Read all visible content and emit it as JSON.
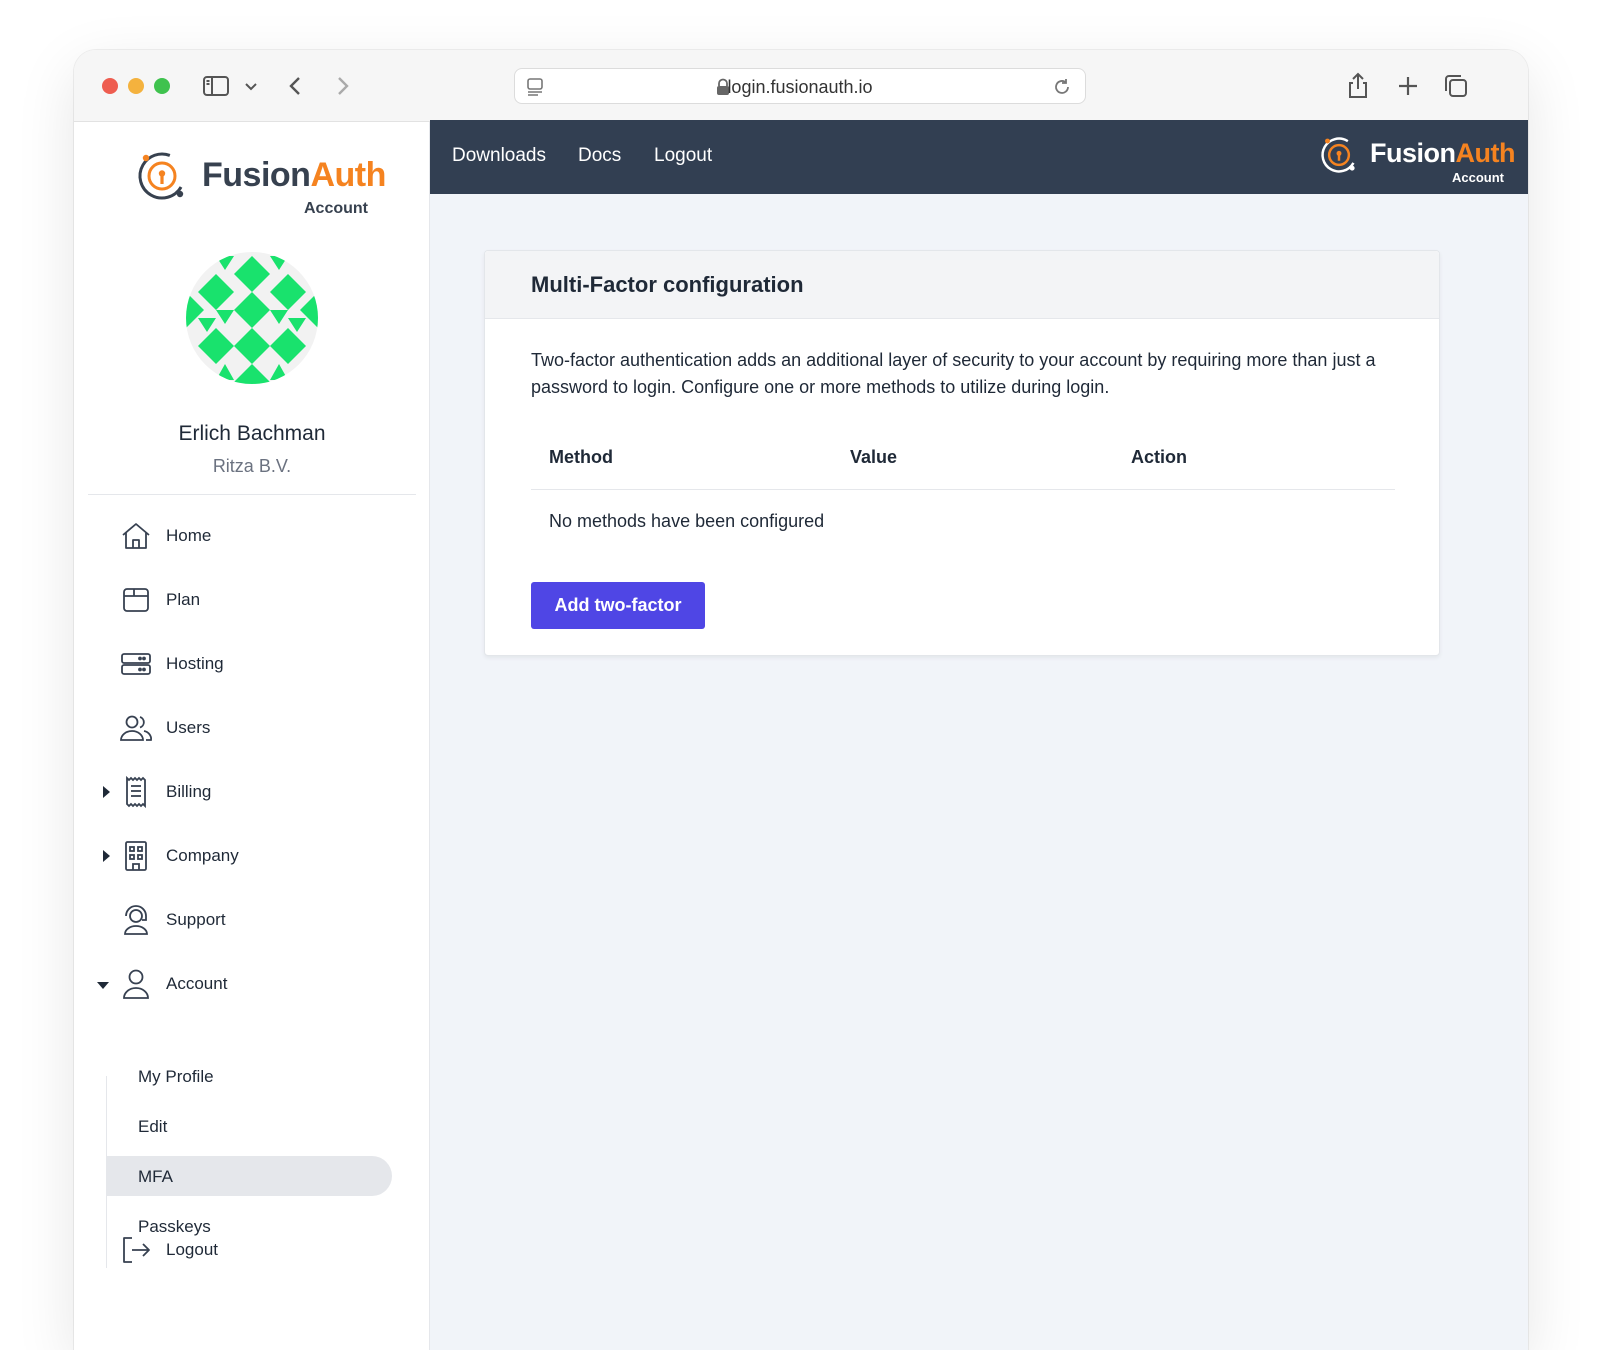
{
  "browser": {
    "url": "login.fusionauth.io"
  },
  "brand": {
    "name_first": "Fusion",
    "name_second": "Auth",
    "sub": "Account",
    "accent": "#f58320",
    "dark": "#323f52"
  },
  "user": {
    "name": "Erlich Bachman",
    "company": "Ritza B.V."
  },
  "sidebar": {
    "items": [
      {
        "label": "Home",
        "icon": "home-icon"
      },
      {
        "label": "Plan",
        "icon": "plan-icon"
      },
      {
        "label": "Hosting",
        "icon": "server-icon"
      },
      {
        "label": "Users",
        "icon": "users-icon"
      },
      {
        "label": "Billing",
        "icon": "receipt-icon"
      },
      {
        "label": "Company",
        "icon": "building-icon"
      },
      {
        "label": "Support",
        "icon": "headset-icon"
      },
      {
        "label": "Account",
        "icon": "user-icon"
      }
    ],
    "account_sub": [
      {
        "label": "My Profile"
      },
      {
        "label": "Edit"
      },
      {
        "label": "MFA",
        "active": true
      },
      {
        "label": "Passkeys"
      }
    ],
    "logout": {
      "label": "Logout",
      "icon": "logout-icon"
    }
  },
  "topnav": {
    "links": [
      "Downloads",
      "Docs",
      "Logout"
    ]
  },
  "mfa": {
    "title": "Multi-Factor configuration",
    "description": "Two-factor authentication adds an additional layer of security to your account by requiring more than just a password to login. Configure one or more methods to utilize during login.",
    "columns": [
      "Method",
      "Value",
      "Action"
    ],
    "empty_message": "No methods have been configured",
    "add_button": "Add two-factor",
    "button_color": "#4f46e5"
  }
}
